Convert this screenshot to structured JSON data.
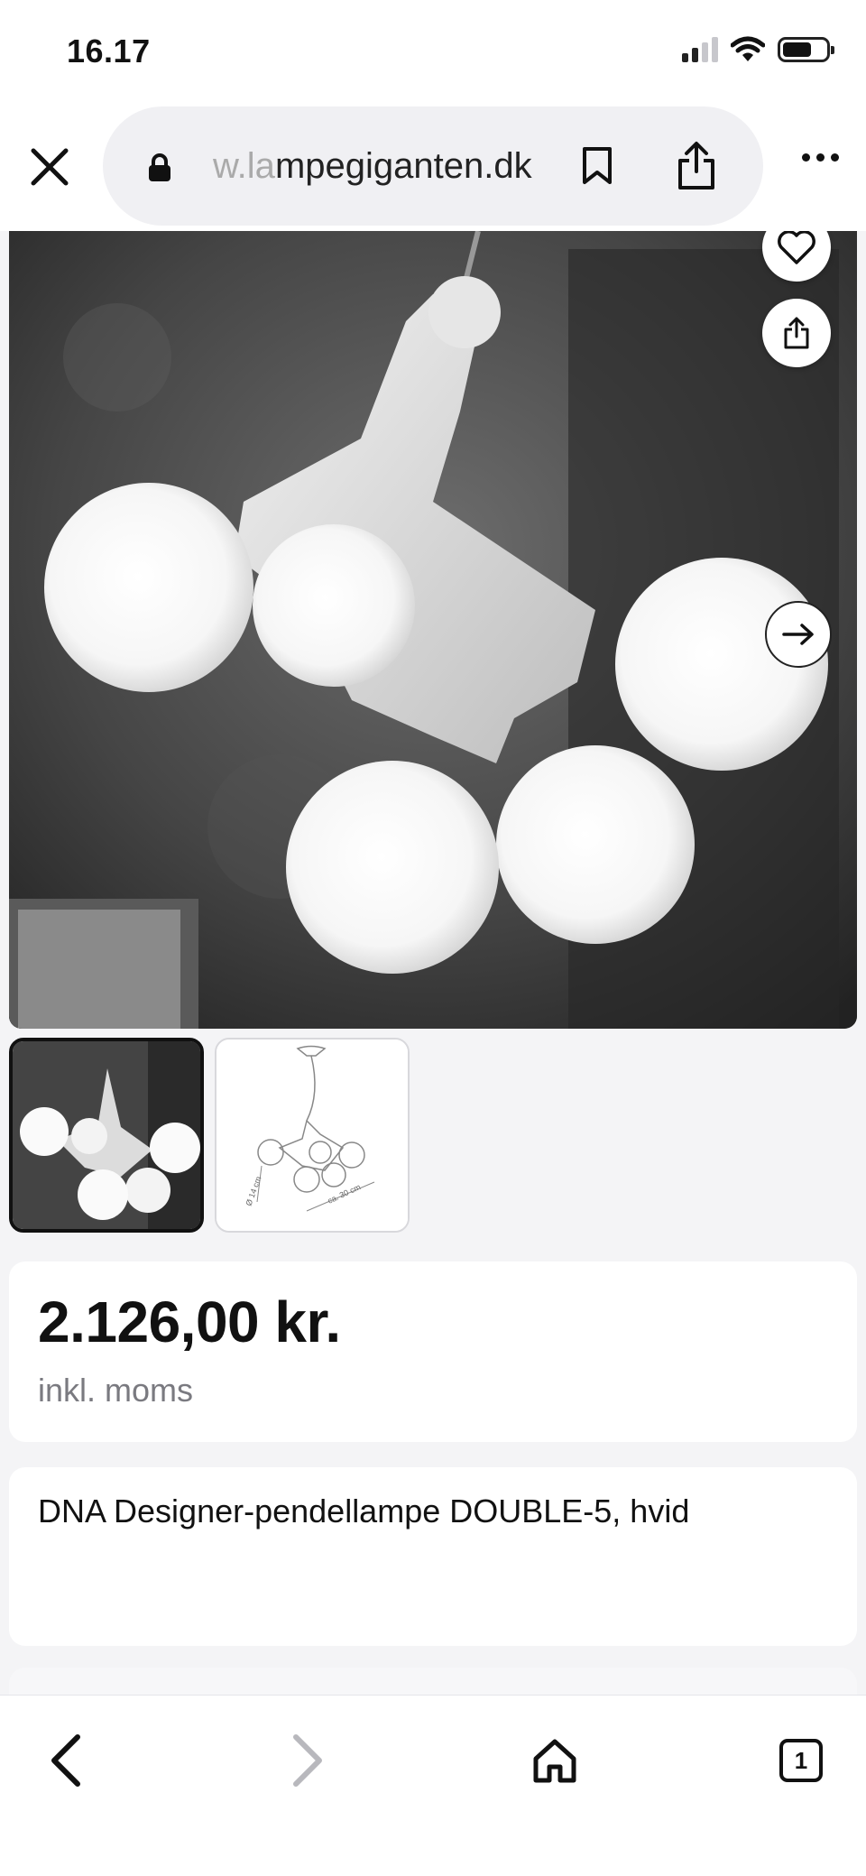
{
  "status": {
    "time": "16.17",
    "icons": [
      "signal-icon",
      "wifi-icon",
      "battery-icon"
    ]
  },
  "browser": {
    "url_prefix": "w.la",
    "url_main": "mpegiganten.dk",
    "icons": [
      "close-icon",
      "lock-icon",
      "bookmark-icon",
      "share-icon",
      "more-icon"
    ]
  },
  "gallery": {
    "image_count": 2,
    "selected_index": 0,
    "thumb2_dimension_1": "Ø 14 cm",
    "thumb2_dimension_2": "ca. 30 cm"
  },
  "product": {
    "price": "2.126,00 kr.",
    "vat_note": "inkl. moms",
    "title": "DNA Designer-pendellampe DOUBLE-5, hvid"
  },
  "toolbar": {
    "tabs_count": "1",
    "icons": [
      "back-icon",
      "forward-icon",
      "home-icon",
      "tabs-icon"
    ]
  },
  "colors": {
    "background": "#f4f4f6",
    "card": "#ffffff",
    "text": "#111111",
    "muted": "#7a7a80",
    "disabled": "#b8b8bd"
  }
}
